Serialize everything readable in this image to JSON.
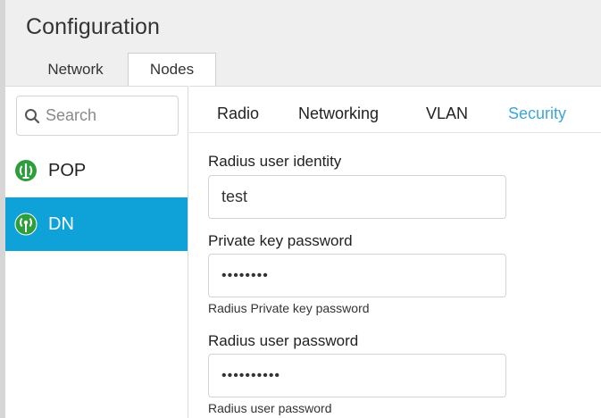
{
  "header": {
    "title": "Configuration",
    "tabs": [
      {
        "label": "Network"
      },
      {
        "label": "Nodes"
      }
    ]
  },
  "sidebar": {
    "search": {
      "placeholder": "Search",
      "icon": "search-icon"
    },
    "nodes": [
      {
        "label": "POP",
        "icon": "pop-node-icon",
        "icon_color": "#2e9e3c"
      },
      {
        "label": "DN",
        "icon": "dn-node-icon",
        "icon_color": "#2e9e3c",
        "selected": true
      }
    ]
  },
  "content": {
    "tabs": [
      {
        "label": "Radio"
      },
      {
        "label": "Networking"
      },
      {
        "label": "VLAN"
      },
      {
        "label": "Security",
        "active": true
      }
    ],
    "fields": {
      "radius_identity": {
        "label": "Radius user identity",
        "value": "test"
      },
      "private_key_password": {
        "label": "Private key password",
        "value": "••••••••",
        "helper": "Radius Private key password"
      },
      "radius_user_password": {
        "label": "Radius user password",
        "value": "••••••••••",
        "helper": "Radius user password"
      }
    }
  },
  "colors": {
    "accent": "#0ea2d9",
    "active_tab_text": "#3ea6d9",
    "node_icon": "#2e9e3c"
  }
}
